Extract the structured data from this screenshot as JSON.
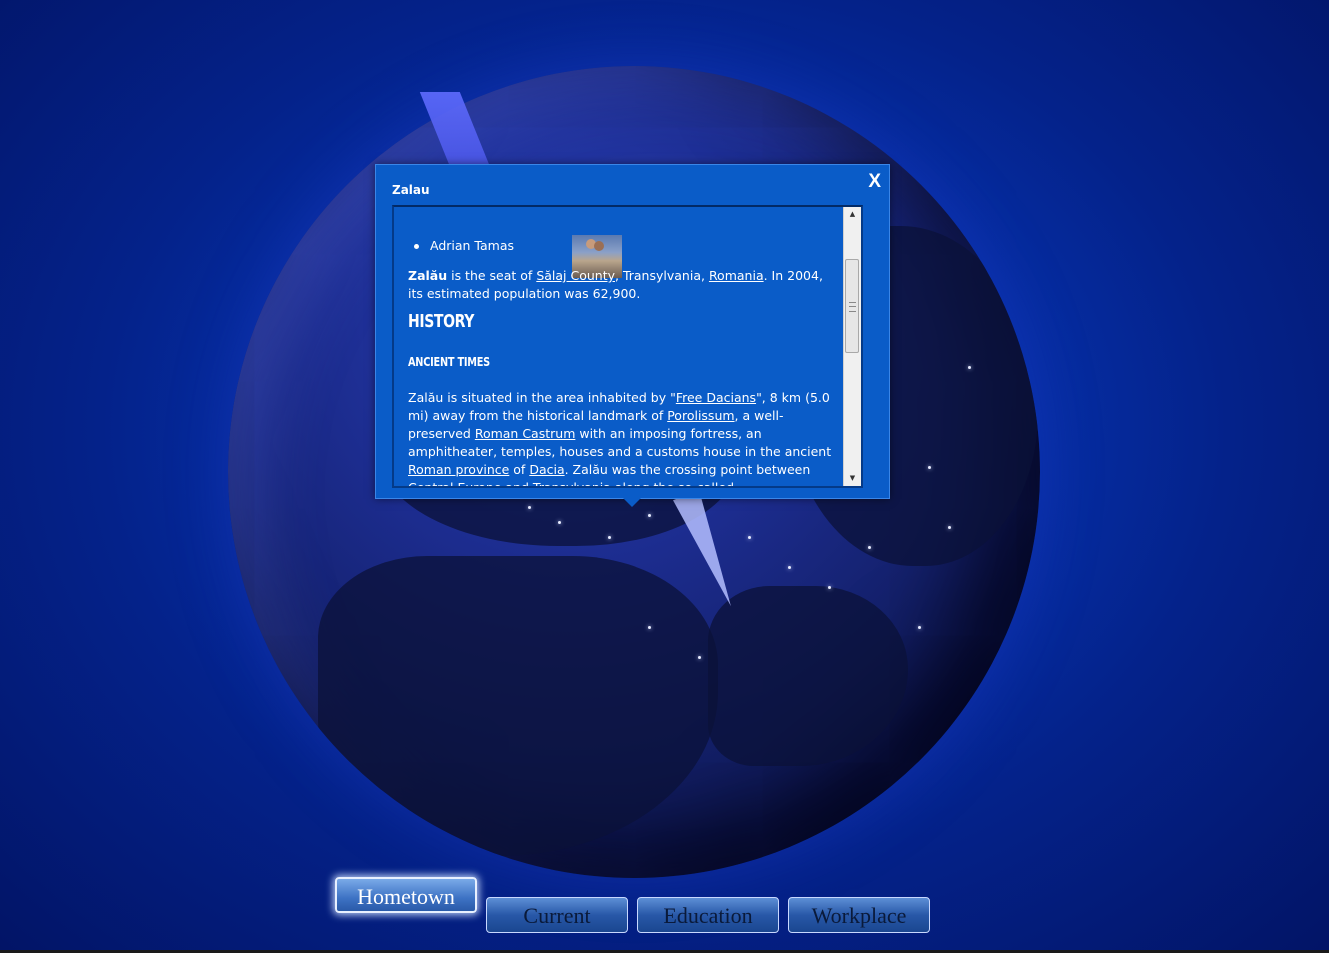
{
  "popup": {
    "title": "Zalau",
    "close_label": "X",
    "friends": [
      "Adrian Tamas"
    ],
    "intro": {
      "bold_name": "Zalău",
      "text1": " is the seat of ",
      "link1": "Sălaj County",
      "text2": ", Transylvania, ",
      "link2": "Romania",
      "text3": ". In 2004, its estimated population was 62,900."
    },
    "heading_history": "History",
    "heading_ancient": "Ancient times",
    "ancient": {
      "text1": "Zalău is situated in the area inhabited by \"",
      "link1": "Free Dacians",
      "text2": "\", 8 km (5.0 mi) away from the historical landmark of ",
      "link2": "Porolissum",
      "text3": ", a well-preserved ",
      "link3": "Roman Castrum",
      "text4": " with an imposing fortress, an amphitheater, temples, houses and a customs house in the ancient ",
      "link4": "Roman province",
      "text5": " of ",
      "link5": "Dacia",
      "text6": ". Zalău was the crossing point between Central Europe and Transylvania along the so-called"
    }
  },
  "tabs": [
    {
      "label": "Hometown",
      "active": true
    },
    {
      "label": "Current",
      "active": false
    },
    {
      "label": "Education",
      "active": false
    },
    {
      "label": "Workplace",
      "active": false
    }
  ]
}
